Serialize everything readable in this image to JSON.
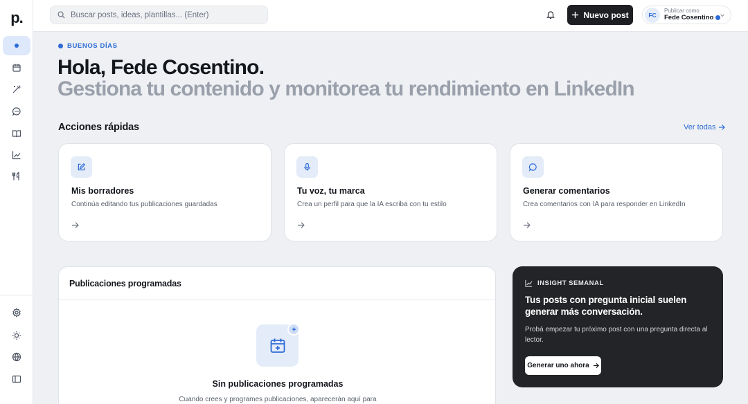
{
  "app": {
    "logo": "p",
    "logo_dot": "."
  },
  "search": {
    "placeholder": "Buscar posts, ideas, plantillas... (Enter)"
  },
  "header": {
    "new_post_label": "Nuevo post",
    "account": {
      "initials": "FC",
      "subtitle": "Publicar como",
      "name": "Fede Cosentino"
    }
  },
  "sidebar": {
    "items": [
      {
        "icon": "home-dot-icon",
        "active": true
      },
      {
        "icon": "calendar-icon"
      },
      {
        "icon": "magic-wand-icon"
      },
      {
        "icon": "chat-icon"
      },
      {
        "icon": "book-icon"
      },
      {
        "icon": "chart-line-icon"
      },
      {
        "icon": "utensils-icon"
      }
    ],
    "bottom": [
      {
        "icon": "gear-icon"
      },
      {
        "icon": "sun-icon"
      },
      {
        "icon": "globe-icon"
      },
      {
        "icon": "sidebar-toggle-icon"
      }
    ]
  },
  "main": {
    "greeting": "BUENOS DÍAS",
    "title": "Hola, Fede Cosentino.",
    "subtitle": "Gestiona tu contenido y monitorea tu rendimiento en LinkedIn",
    "quick_actions": {
      "title": "Acciones rápidas",
      "see_all": "Ver todas",
      "cards": [
        {
          "icon": "edit-icon",
          "title": "Mis borradores",
          "desc": "Continúa editando tus publicaciones guardadas"
        },
        {
          "icon": "microphone-icon",
          "title": "Tu voz, tu marca",
          "desc": "Crea un perfil para que la IA escriba con tu estilo"
        },
        {
          "icon": "comment-icon",
          "title": "Generar comentarios",
          "desc": "Crea comentarios con IA para responder en LinkedIn"
        }
      ]
    },
    "scheduled": {
      "title": "Publicaciones programadas",
      "empty_title": "Sin publicaciones programadas",
      "empty_desc": "Cuando crees y programes publicaciones, aparecerán aquí para"
    },
    "insight": {
      "tag": "INSIGHT SEMANAL",
      "title": "Tus posts con pregunta inicial suelen generar más conversación.",
      "desc": "Probá empezar tu próximo post con una pregunta directa al lector.",
      "button": "Generar uno ahora"
    }
  },
  "colors": {
    "accent": "#2d6bd6",
    "dark": "#232427",
    "background": "#eef0f3"
  }
}
